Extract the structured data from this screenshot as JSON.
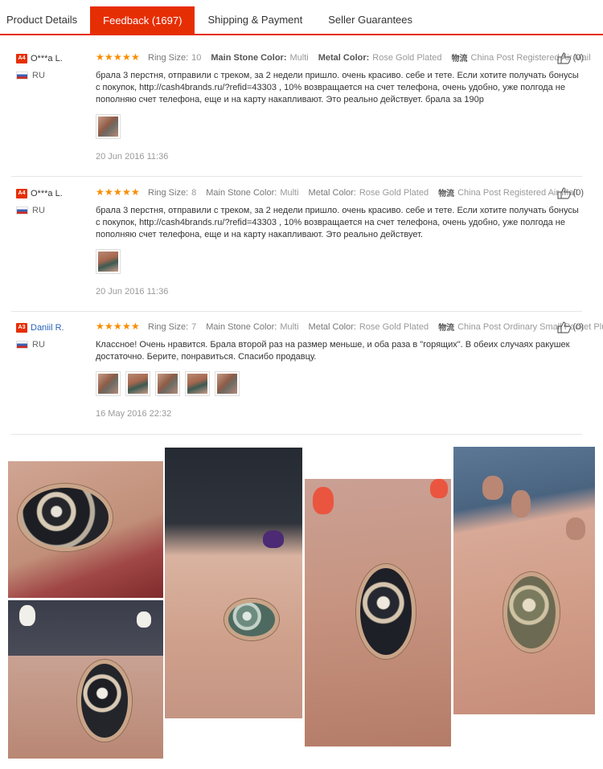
{
  "tabs": [
    {
      "label": "Product Details",
      "active": false
    },
    {
      "label": "Feedback (1697)",
      "active": true
    },
    {
      "label": "Shipping & Payment",
      "active": false
    },
    {
      "label": "Seller Guarantees",
      "active": false
    }
  ],
  "reviews": [
    {
      "level": "A4",
      "name": "O***a L.",
      "country": "RU",
      "rating": 5,
      "ring_size_label": "Ring Size:",
      "ring_size": "10",
      "stone_label": "Main Stone Color:",
      "stone": "Multi",
      "metal_label": "Metal Color:",
      "metal": "Rose Gold Plated",
      "shipping_label": "物流",
      "shipping": "China Post Registered Air Mail",
      "helpful": "(0)",
      "text": "брала 3 перстня, отправили с треком, за 2 недели пришло. очень красиво. себе и тете. Если хотите получать бонусы с покупок, http://cash4brands.ru/?refid=43303 , 10% возвращается на счет телефона, очень удобно, уже полгода не пополняю счет телефона, еще и на карту накапливают. Это реально действует. брала за 190р",
      "photos": 1,
      "date": "20 Jun 2016 11:36"
    },
    {
      "level": "A4",
      "name": "O***a L.",
      "country": "RU",
      "rating": 5,
      "ring_size_label": "Ring Size:",
      "ring_size": "8",
      "stone_label": "Main Stone Color:",
      "stone": "Multi",
      "metal_label": "Metal Color:",
      "metal": "Rose Gold Plated",
      "shipping_label": "物流",
      "shipping": "China Post Registered Air Mail",
      "helpful": "(0)",
      "text": "брала 3 перстня, отправили с треком, за 2 недели пришло. очень красиво. себе и тете. Если хотите получать бонусы с покупок, http://cash4brands.ru/?refid=43303 , 10% возвращается на счет телефона, очень удобно, уже полгода не пополняю счет телефона, еще и на карту накапливают. Это реально действует.",
      "photos": 1,
      "date": "20 Jun 2016 11:36"
    },
    {
      "level": "A3",
      "name": "Daniil R.",
      "country": "RU",
      "rating": 5,
      "ring_size_label": "Ring Size:",
      "ring_size": "7",
      "stone_label": "Main Stone Color:",
      "stone": "Multi",
      "metal_label": "Metal Color:",
      "metal": "Rose Gold Plated",
      "shipping_label": "物流",
      "shipping": "China Post Ordinary Small Packet Plus",
      "helpful": "(0)",
      "text": "Классное! Очень нравится. Брала второй раз на размер меньше, и оба раза в \"горящих\". В обеих случаях ракушек достаточно. Берите, понравиться. Спасибо продавцу.",
      "photos": 5,
      "date": "16 May 2016 22:32"
    }
  ],
  "colors": {
    "accent": "#e62e04",
    "star": "#fa8c00",
    "link": "#2a62b8",
    "ring_metal": "#c9a488"
  },
  "icons": {
    "level_badge": "level-badge",
    "flag": "russia-flag-icon",
    "like": "thumbs-up-icon",
    "star": "star-icon"
  }
}
